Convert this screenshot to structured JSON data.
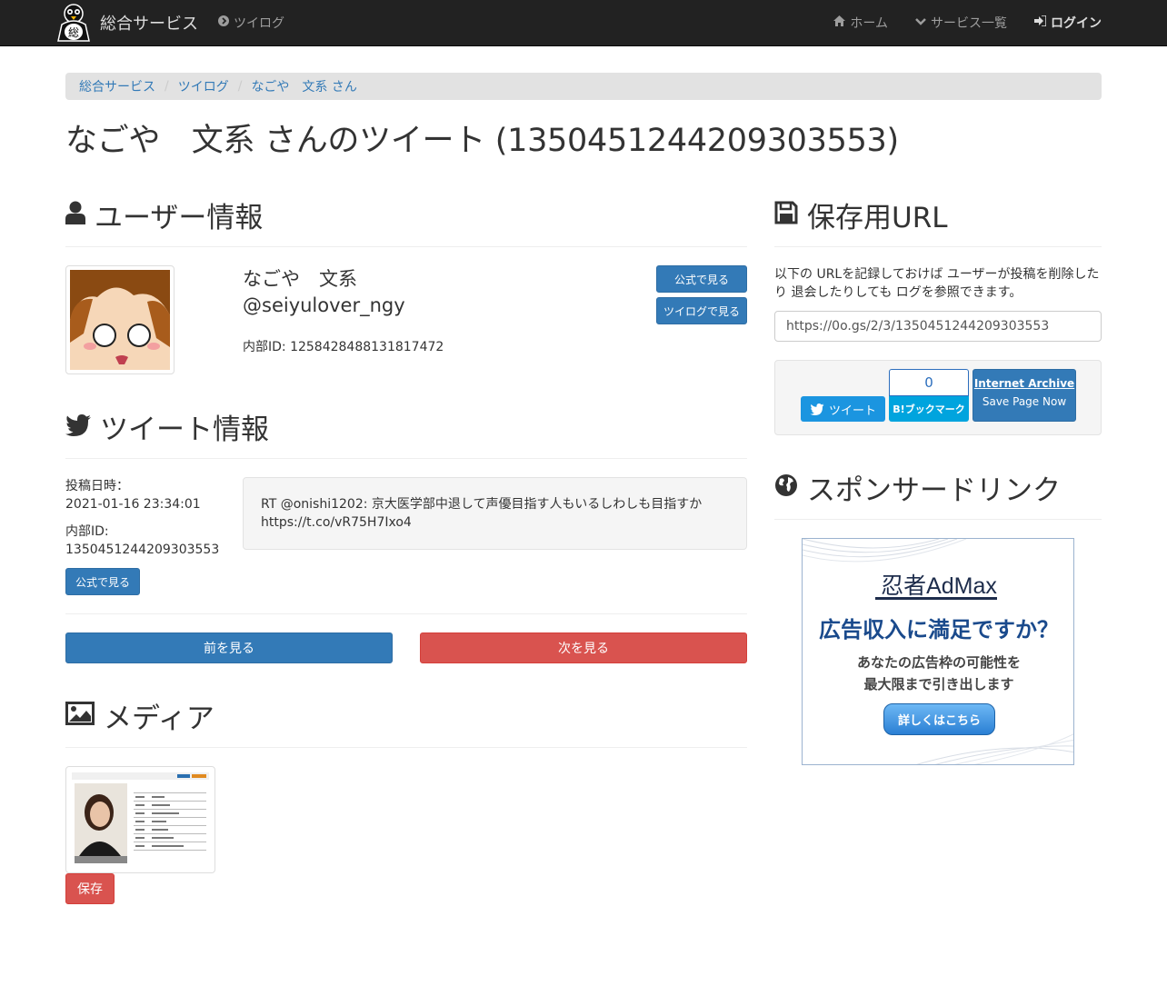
{
  "navbar": {
    "brand": "総合サービス",
    "left_item": "ツイログ",
    "right_items": [
      "ホーム",
      "サービス一覧",
      "ログイン"
    ]
  },
  "breadcrumb": [
    "総合サービス",
    "ツイログ",
    "なごや　文系 さん"
  ],
  "page_title": "なごや　文系 さんのツイート (1350451244209303553)",
  "user_section": {
    "heading": "ユーザー情報",
    "name": "なごや　文系",
    "handle": "@seiyulover_ngy",
    "internal_id": "内部ID: 1258428488131817472",
    "btn_official": "公式で見る",
    "btn_twilog": "ツイログで見る"
  },
  "tweet_section": {
    "heading": "ツイート情報",
    "posted_label": "投稿日時：",
    "posted_value": "2021-01-16 23:34:01",
    "id_label": "内部ID:",
    "id_value": "1350451244209303553",
    "btn_official": "公式で見る",
    "text_line1": "RT @onishi1202: 京大医学部中退して声優目指す人もいるしわしも目指すか",
    "text_line2": "https://t.co/vR75H7Ixo4"
  },
  "pager": {
    "prev": "前を見る",
    "next": "次を見る"
  },
  "media_section": {
    "heading": "メディア",
    "save_btn": "保存"
  },
  "save_section": {
    "heading": "保存用URL",
    "description": "以下の URLを記録しておけば ユーザーが投稿を削除したり 退会したりしても ログを参照できます。",
    "url": "https://0o.gs/2/3/1350451244209303553",
    "tweet_btn": "ツイート",
    "hatena_count": "0",
    "hatena_btn": "B!ブックマーク",
    "ia_top": "Internet Archive",
    "ia_bottom": "Save Page Now"
  },
  "sponsor_section": {
    "heading": "スポンサードリンク",
    "ad_logo": "忍者AdMax",
    "ad_title": "広告収入に満足ですか？",
    "ad_line1": "あなたの広告枠の可能性を",
    "ad_line2": "最大限まで引き出します",
    "ad_btn": "詳しくはこちら"
  }
}
